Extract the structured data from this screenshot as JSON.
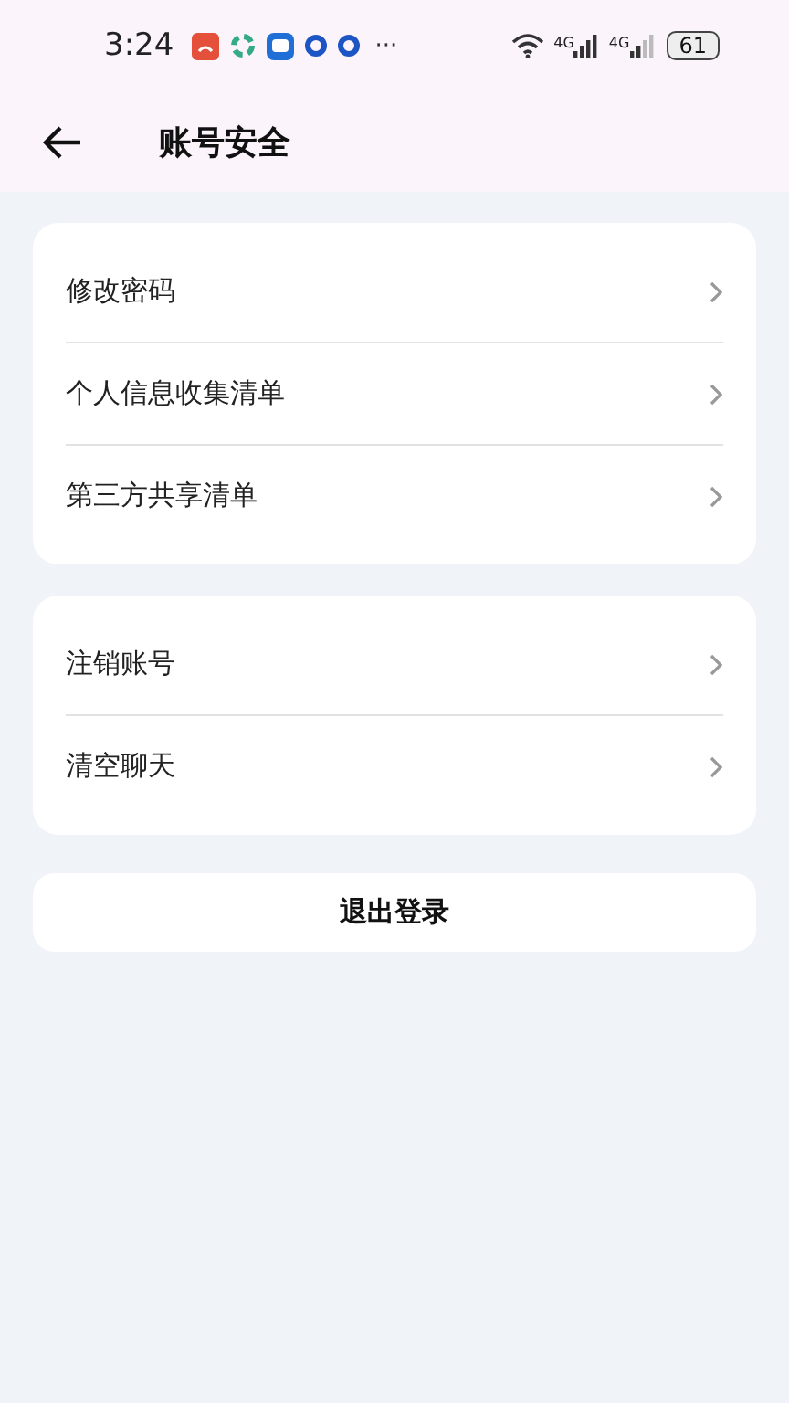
{
  "status_bar": {
    "time": "3:24",
    "more": "···",
    "networks": [
      {
        "label": "4G"
      },
      {
        "label": "4G"
      }
    ],
    "battery": "61"
  },
  "header": {
    "title": "账号安全"
  },
  "groups": [
    {
      "items": [
        {
          "label": "修改密码"
        },
        {
          "label": "个人信息收集清单"
        },
        {
          "label": "第三方共享清单"
        }
      ]
    },
    {
      "items": [
        {
          "label": "注销账号"
        },
        {
          "label": "清空聊天"
        }
      ]
    }
  ],
  "logout_button": "退出登录"
}
